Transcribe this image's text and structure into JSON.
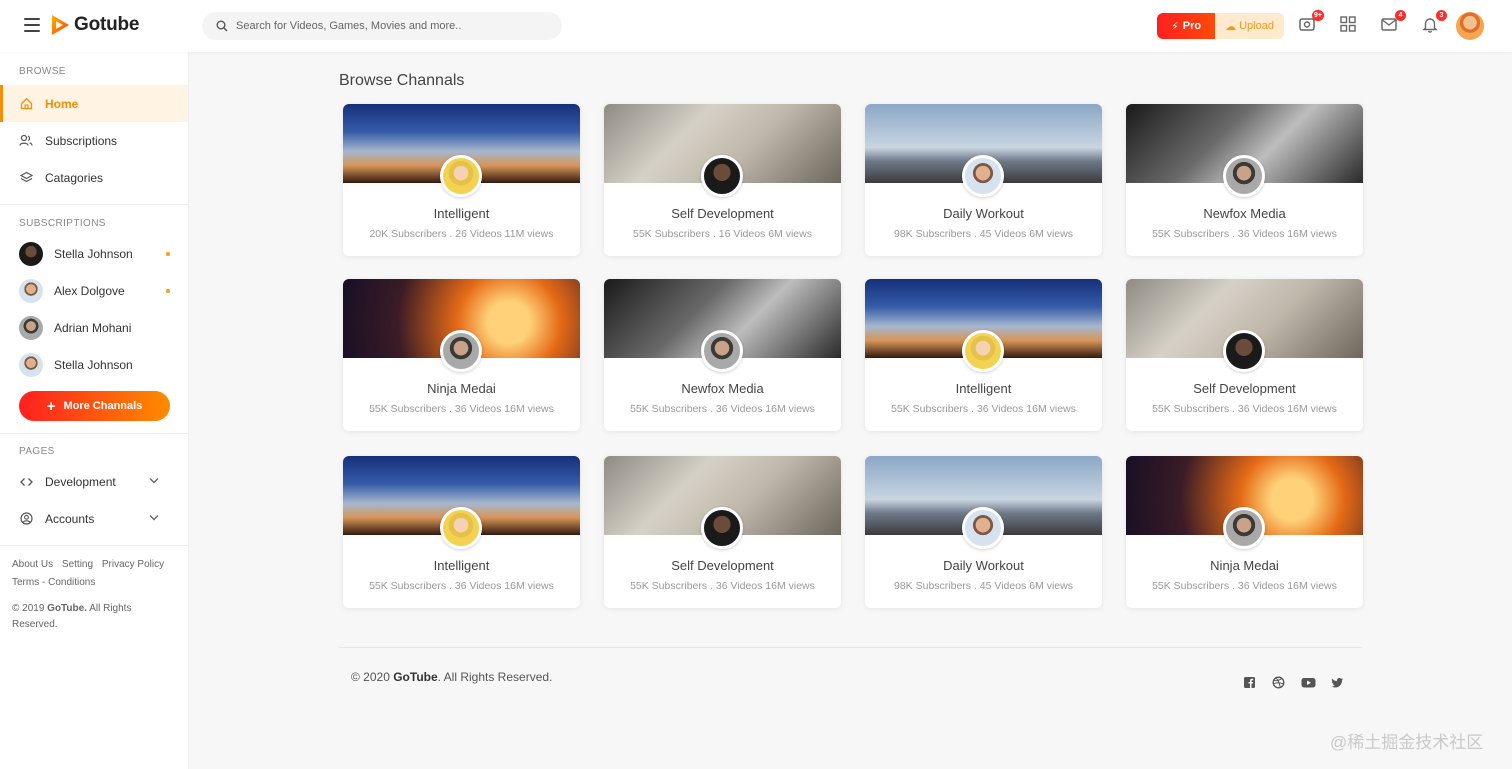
{
  "header": {
    "logo_text": "Gotube",
    "search_placeholder": "Search for Videos, Games, Movies and more..",
    "pro_label": "Pro",
    "upload_label": "Upload",
    "badges": {
      "video": "9+",
      "mail": "4",
      "bell": "3"
    }
  },
  "sidebar": {
    "browse_title": "BROWSE",
    "browse_items": [
      {
        "label": "Home",
        "icon": "home-icon"
      },
      {
        "label": "Subscriptions",
        "icon": "users-icon"
      },
      {
        "label": "Catagories",
        "icon": "layers-icon"
      }
    ],
    "subscriptions_title": "SUBSCRIPTIONS",
    "subscriptions": [
      {
        "name": "Stella Johnson"
      },
      {
        "name": "Alex Dolgove"
      },
      {
        "name": "Adrian Mohani"
      },
      {
        "name": "Stella Johnson"
      }
    ],
    "more_label": "More Channals",
    "pages_title": "PAGES",
    "pages_items": [
      {
        "label": "Development",
        "icon": "code-icon"
      },
      {
        "label": "Accounts",
        "icon": "user-circle-icon"
      }
    ],
    "footer_links": [
      "About Us",
      "Setting",
      "Privacy Policy",
      "Terms - Conditions"
    ],
    "copyright_prefix": "© 2019 ",
    "copyright_brand": "GoTube.",
    "copyright_suffix": " All Rights Reserved."
  },
  "main": {
    "title": "Browse Channals",
    "cards": [
      {
        "name": "Intelligent",
        "stats": "20K Subscribers . 26 Videos 11M views"
      },
      {
        "name": "Self Development",
        "stats": "55K Subscribers . 16 Videos 6M views"
      },
      {
        "name": "Daily Workout",
        "stats": "98K Subscribers . 45 Videos 6M views"
      },
      {
        "name": "Newfox Media",
        "stats": "55K Subscribers . 36 Videos 16M views"
      },
      {
        "name": "Ninja Medai",
        "stats": "55K Subscribers . 36 Videos 16M views"
      },
      {
        "name": "Newfox Media",
        "stats": "55K Subscribers . 36 Videos 16M views"
      },
      {
        "name": "Intelligent",
        "stats": "55K Subscribers . 36 Videos 16M views"
      },
      {
        "name": "Self Development",
        "stats": "55K Subscribers . 36 Videos 16M views"
      },
      {
        "name": "Intelligent",
        "stats": "55K Subscribers . 36 Videos 16M views"
      },
      {
        "name": "Self Development",
        "stats": "55K Subscribers . 36 Videos 16M views"
      },
      {
        "name": "Daily Workout",
        "stats": "98K Subscribers . 45 Videos 6M views"
      },
      {
        "name": "Ninja Medai",
        "stats": "55K Subscribers . 36 Videos 16M views"
      }
    ]
  },
  "footer": {
    "copyright_prefix": "© 2020 ",
    "copyright_brand": "GoTube",
    "copyright_suffix": ". All Rights Reserved.",
    "social_icons": [
      "facebook-icon",
      "dribbble-icon",
      "youtube-icon",
      "twitter-icon"
    ]
  },
  "watermark": "@稀土掘金技术社区",
  "colors": {
    "accent": "#f48c06",
    "pro_red": "#ff1f1f",
    "badge_red": "#ff2c2c"
  }
}
